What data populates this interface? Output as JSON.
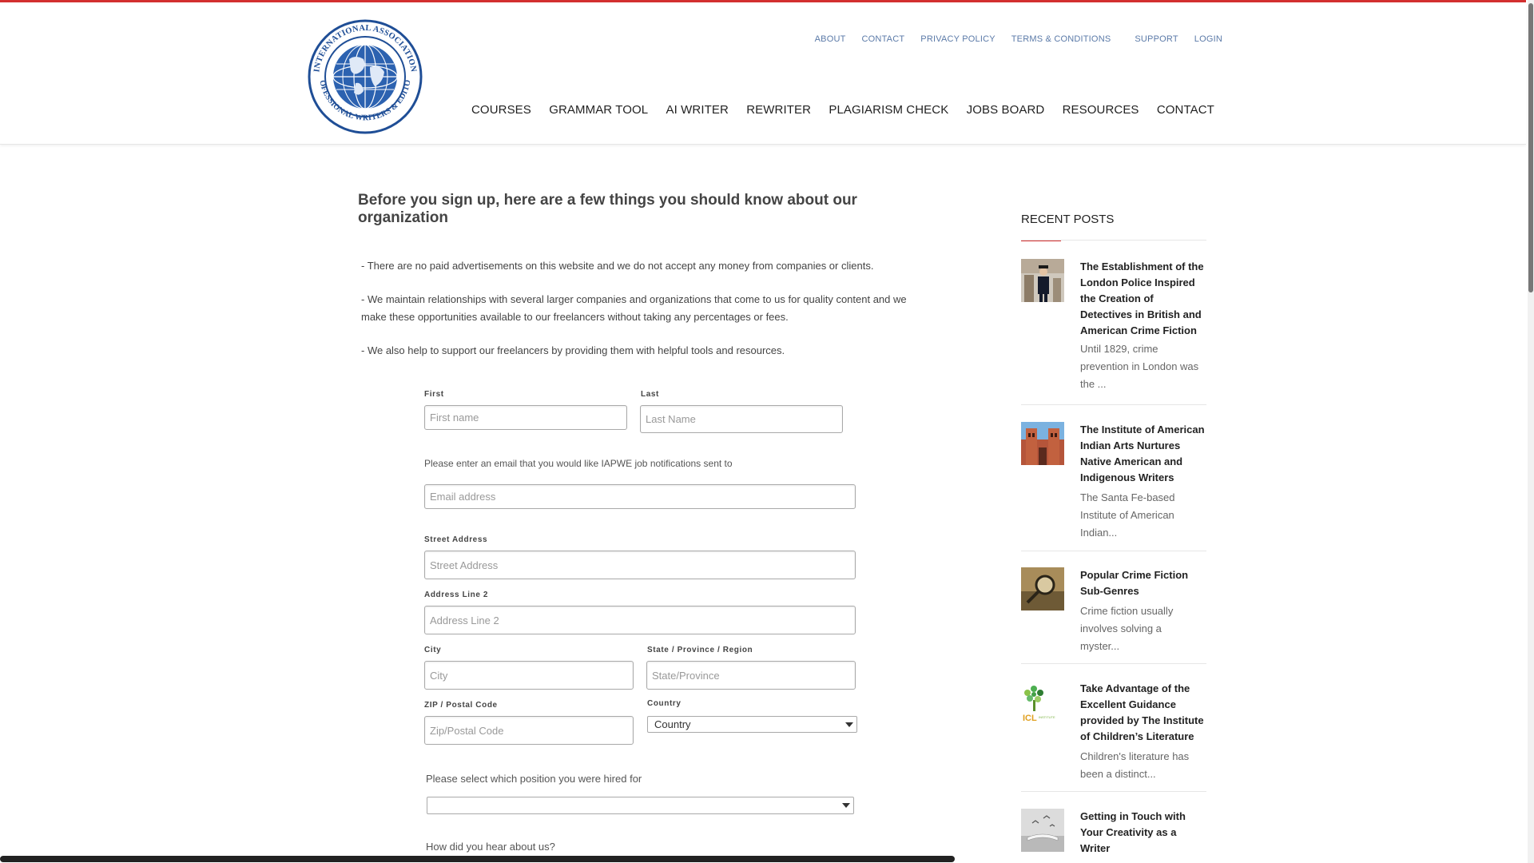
{
  "logo": {
    "alt": "International Association of Professional Writers & Editors",
    "ring_text_top": "INTERNATIONAL ASSOCIATION",
    "ring_text_bottom": "PROFESSIONAL WRITERS & EDITORS",
    "colors": {
      "ring": "#1f4e96",
      "globe": "#1f4e96"
    }
  },
  "util_nav": [
    "ABOUT",
    "CONTACT",
    "PRIVACY POLICY",
    "TERMS & CONDITIONS",
    "SUPPORT",
    "LOGIN"
  ],
  "main_nav": [
    "COURSES",
    "GRAMMAR TOOL",
    "AI WRITER",
    "REWRITER",
    "PLAGIARISM CHECK",
    "JOBS BOARD",
    "RESOURCES",
    "CONTACT"
  ],
  "intro": {
    "title": "Before you sign up, here are a few things you should know about our organization",
    "points": [
      "- There are no paid advertisements on this website and we do not accept any money from companies or clients.",
      "- We maintain relationships with several larger companies and organizations that come to us for quality content and we make these opportunities available to our freelancers without taking any percentages or fees.",
      "- We also help to support our freelancers by providing them with helpful tools and resources."
    ]
  },
  "form": {
    "first_label": "First",
    "first_placeholder": "First name",
    "last_label": "Last",
    "last_placeholder": "Last Name",
    "email_note": "Please enter an email that you would like IAPWE job notifications sent to",
    "email_placeholder": "Email address",
    "street_label": "Street Address",
    "street_placeholder": "Street Address",
    "address2_label": "Address Line 2",
    "address2_placeholder": "Address Line 2",
    "city_label": "City",
    "city_placeholder": "City",
    "state_label": "State / Province / Region",
    "state_placeholder": "State/Province",
    "zip_label": "ZIP / Postal Code",
    "zip_placeholder": "Zip/Postal Code",
    "country_label": "Country",
    "country_value": "Country",
    "position_question": "Please select which position you were hired for",
    "position_value": "",
    "hear_question": "How did you hear about us?"
  },
  "sidebar": {
    "title": "RECENT POSTS",
    "accent_color": "#d32f2f",
    "posts": [
      {
        "title": "The Establishment of the London Police Inspired the Creation of Detectives in British and American Crime Fiction",
        "excerpt": "Until 1829, crime prevention in London was the ...",
        "thumb": "policeman-photo"
      },
      {
        "title": "The Institute of American Indian Arts Nurtures Native American and Indigenous Writers",
        "excerpt": "The Santa Fe-based Institute of American Indian...",
        "thumb": "building-photo"
      },
      {
        "title": "Popular Crime Fiction Sub-Genres",
        "excerpt": "Crime fiction usually involves solving a myster...",
        "thumb": "magnifier-photo"
      },
      {
        "title": "Take Advantage of the Excellent Guidance provided by The Institute of Children’s Literature",
        "excerpt": "Children's literature has been a distinct...",
        "thumb": "icl-tree-logo"
      },
      {
        "title": "Getting in Touch with Your Creativity as a Writer",
        "excerpt": "",
        "thumb": "book-birds-photo"
      }
    ]
  }
}
